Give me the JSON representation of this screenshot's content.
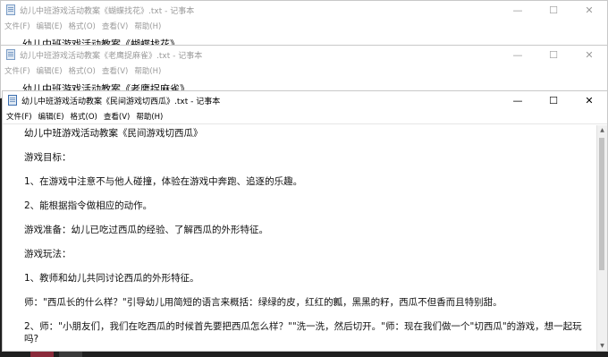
{
  "windows": [
    {
      "title": "幼儿中班游戏活动教案《蝴蝶找花》.txt - 记事本",
      "first_line": "幼儿中班游戏活动教案《蝴蝶找花》"
    },
    {
      "title": "幼儿中班游戏活动教案《老鹰捉麻雀》.txt - 记事本",
      "first_line": "幼儿中班游戏活动教案《老鹰捉麻雀》"
    },
    {
      "title": "幼儿中班游戏活动教案《民间游戏切西瓜》.txt - 记事本",
      "lines": [
        "幼儿中班游戏活动教案《民间游戏切西瓜》",
        "游戏目标：",
        "1、在游戏中注意不与他人碰撞，体验在游戏中奔跑、追逐的乐趣。",
        "2、能根据指令做相应的动作。",
        "游戏准备：幼儿已吃过西瓜的经验、了解西瓜的外形特征。",
        "游戏玩法：",
        "1、教师和幼儿共同讨论西瓜的外形特征。",
        "师：\"西瓜长的什么样？\"引导幼儿用简短的语言来概括：绿绿的皮，红红的瓤，黑黑的籽，西瓜不但香而且特别甜。",
        "2、师：\"小朋友们，我们在吃西瓜的时候首先要把西瓜怎么样？\"\"洗一洗，然后切开。\"师：现在我们做一个\"切西瓜\"的游戏，想一起玩吗?"
      ]
    }
  ],
  "menu": {
    "file": "文件(F)",
    "edit": "编辑(E)",
    "format": "格式(O)",
    "view": "查看(V)",
    "help": "帮助(H)"
  },
  "controls": {
    "minimize": "—",
    "maximize": "☐",
    "close": "✕"
  },
  "icons": {
    "app": "notepad-icon",
    "scroll_up": "▲",
    "scroll_down": "▼"
  }
}
